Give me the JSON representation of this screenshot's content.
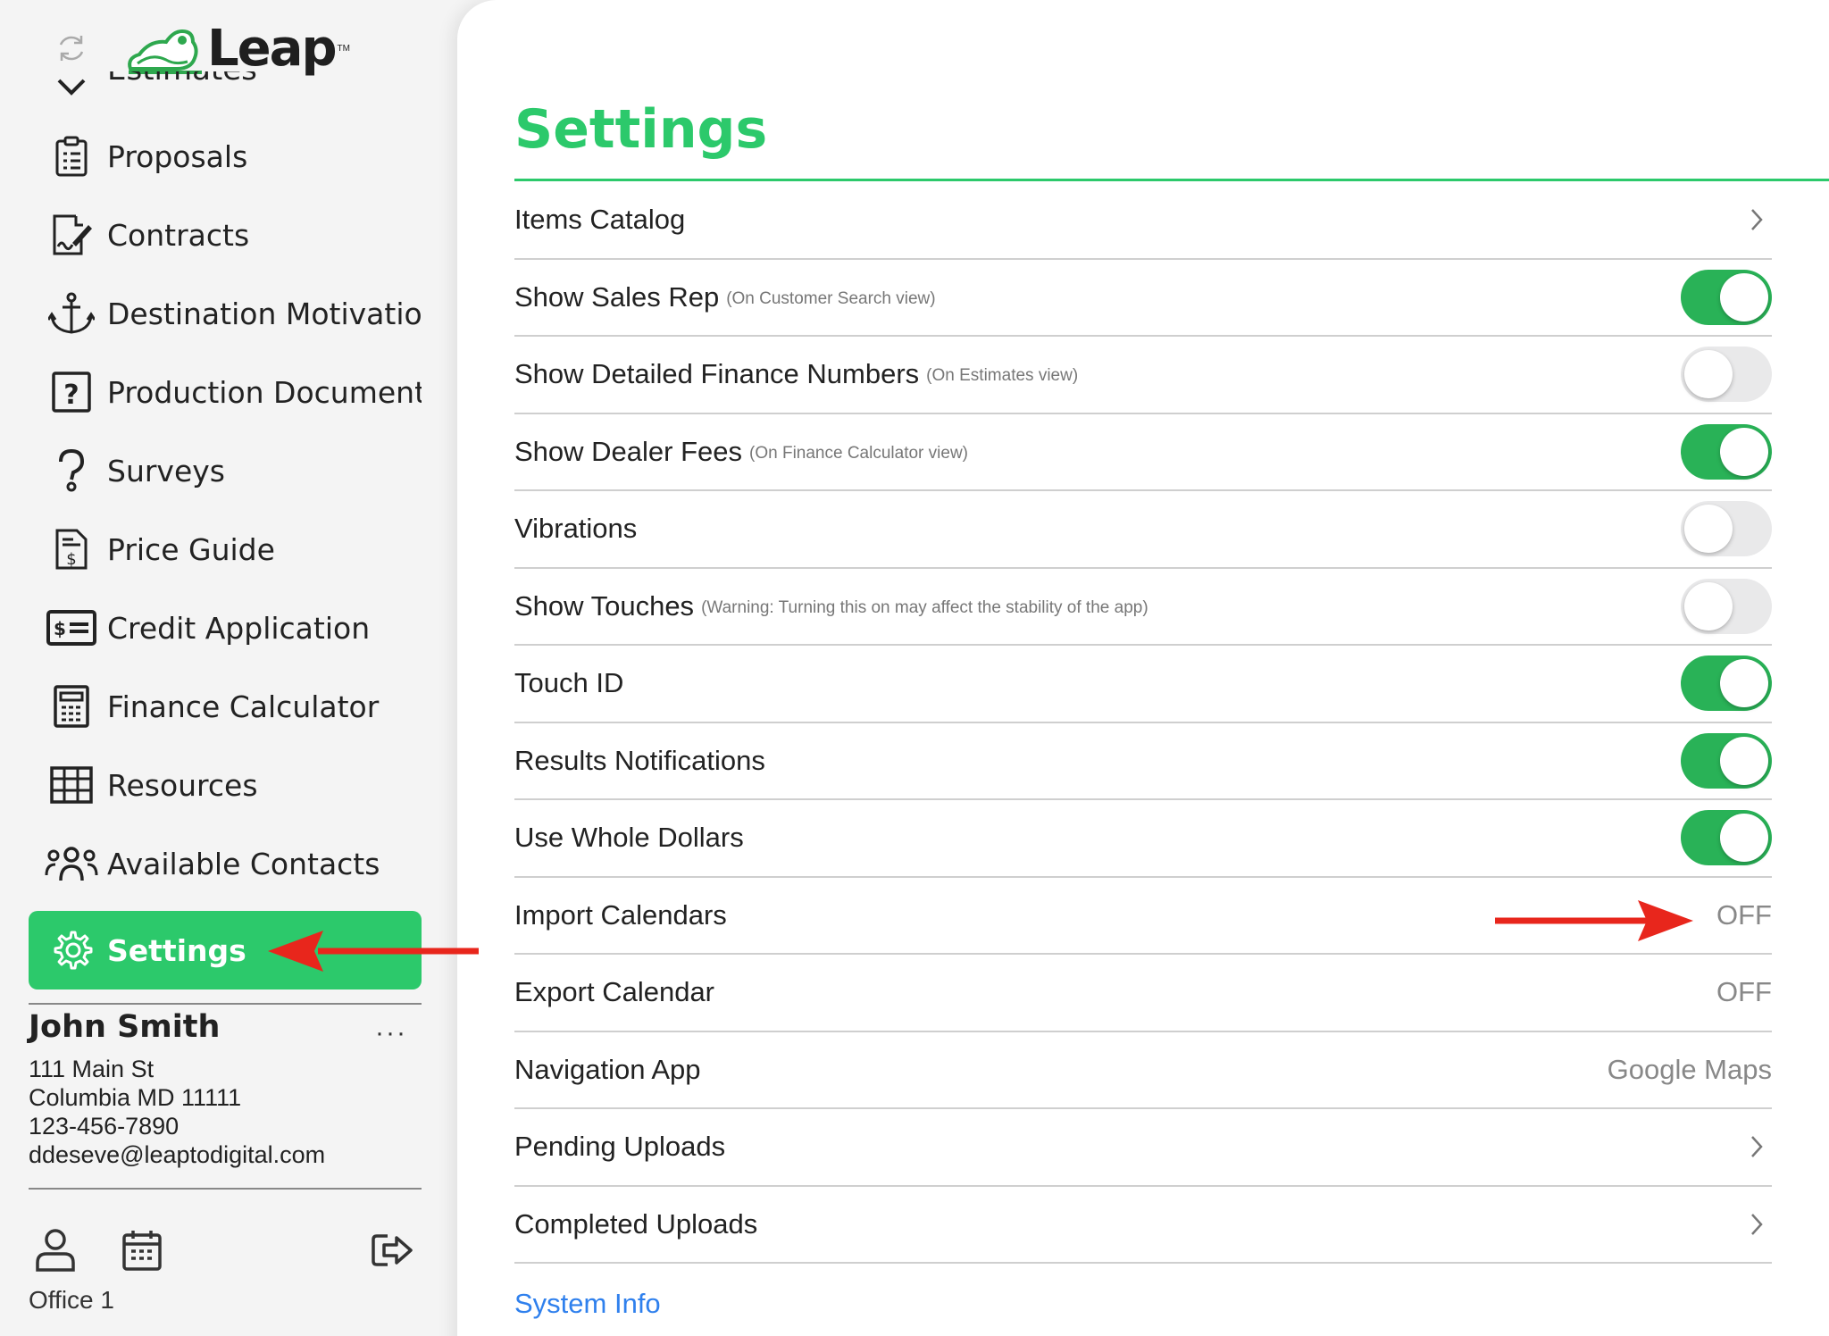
{
  "app": {
    "logo_text": "Leap",
    "logo_tm": "TM"
  },
  "sidebar": {
    "cut_item": "Estimates",
    "items": [
      {
        "label": "Proposals",
        "icon": "clipboard-list-icon"
      },
      {
        "label": "Contracts",
        "icon": "contract-sign-icon"
      },
      {
        "label": "Destination Motivation",
        "icon": "anchor-icon"
      },
      {
        "label": "Production Documents",
        "icon": "question-doc-icon"
      },
      {
        "label": "Surveys",
        "icon": "question-mark-icon"
      },
      {
        "label": "Price Guide",
        "icon": "price-doc-icon"
      },
      {
        "label": "Credit Application",
        "icon": "credit-card-icon"
      },
      {
        "label": "Finance Calculator",
        "icon": "calculator-icon"
      },
      {
        "label": "Resources",
        "icon": "grid-table-icon"
      },
      {
        "label": "Available Contacts",
        "icon": "contacts-icon"
      },
      {
        "label": "Settings",
        "icon": "gear-icon",
        "active": true
      }
    ],
    "user": {
      "name": "John Smith",
      "more": "···",
      "address1": "111 Main St",
      "address2": "Columbia MD 11111",
      "phone": "123-456-7890",
      "email": "ddeseve@leaptodigital.com"
    },
    "office_label": "Office 1"
  },
  "settings": {
    "title": "Settings",
    "rows": [
      {
        "label": "Items Catalog",
        "hint": "",
        "kind": "chevron"
      },
      {
        "label": "Show Sales Rep",
        "hint": "(On Customer Search view)",
        "kind": "toggle",
        "on": true
      },
      {
        "label": "Show Detailed Finance Numbers",
        "hint": "(On Estimates view)",
        "kind": "toggle",
        "on": false
      },
      {
        "label": "Show Dealer Fees",
        "hint": "(On Finance Calculator view)",
        "kind": "toggle",
        "on": true
      },
      {
        "label": "Vibrations",
        "hint": "",
        "kind": "toggle",
        "on": false
      },
      {
        "label": "Show Touches",
        "hint": "(Warning: Turning this on may affect the stability of the app)",
        "kind": "toggle",
        "on": false
      },
      {
        "label": "Touch ID",
        "hint": "",
        "kind": "toggle",
        "on": true
      },
      {
        "label": "Results Notifications",
        "hint": "",
        "kind": "toggle",
        "on": true
      },
      {
        "label": "Use Whole Dollars",
        "hint": "",
        "kind": "toggle",
        "on": true
      },
      {
        "label": "Import Calendars",
        "hint": "",
        "kind": "value",
        "value": "OFF"
      },
      {
        "label": "Export Calendar",
        "hint": "",
        "kind": "value",
        "value": "OFF"
      },
      {
        "label": "Navigation App",
        "hint": "",
        "kind": "value",
        "value": "Google Maps"
      },
      {
        "label": "Pending Uploads",
        "hint": "",
        "kind": "chevron"
      },
      {
        "label": "Completed Uploads",
        "hint": "",
        "kind": "chevron"
      }
    ],
    "system_info": "System Info"
  },
  "colors": {
    "accent": "#2cc96b",
    "toggle_on": "#29b257",
    "link": "#2f80ed",
    "annotation_arrow": "#e8261c"
  }
}
